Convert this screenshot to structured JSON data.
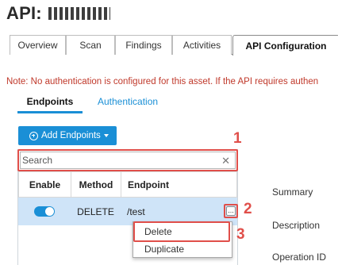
{
  "page": {
    "title_prefix": "API:",
    "title_redacted": true
  },
  "tabs": [
    {
      "label": "Overview",
      "active": false
    },
    {
      "label": "Scan",
      "active": false
    },
    {
      "label": "Findings",
      "active": false
    },
    {
      "label": "Activities",
      "active": false
    },
    {
      "label": "API Configuration",
      "active": true
    }
  ],
  "note": "Note: No authentication is configured for this asset. If the API requires authen",
  "subtabs": [
    {
      "label": "Endpoints",
      "active": true
    },
    {
      "label": "Authentication",
      "active": false
    }
  ],
  "toolbar": {
    "add_label": "Add Endpoints",
    "add_icon": "plus-circle-icon",
    "caret_icon": "caret-down-icon"
  },
  "search": {
    "placeholder": "Search",
    "value": "",
    "clear_icon": "close-icon"
  },
  "table": {
    "columns": [
      "Enable",
      "Method",
      "Endpoint"
    ],
    "rows": [
      {
        "enabled": true,
        "method": "DELETE",
        "endpoint": "/test",
        "selected": true
      }
    ],
    "more_label": "..."
  },
  "row_menu": {
    "items": [
      "Delete",
      "Duplicate"
    ]
  },
  "details": {
    "labels": [
      "Summary",
      "Description",
      "Operation ID"
    ]
  },
  "annotations": [
    "1",
    "2",
    "3"
  ],
  "colors": {
    "accent": "#1a8fd6",
    "note_text": "#c0392b",
    "selected_row": "#cfe4f8",
    "annotation": "#e04f4a"
  }
}
